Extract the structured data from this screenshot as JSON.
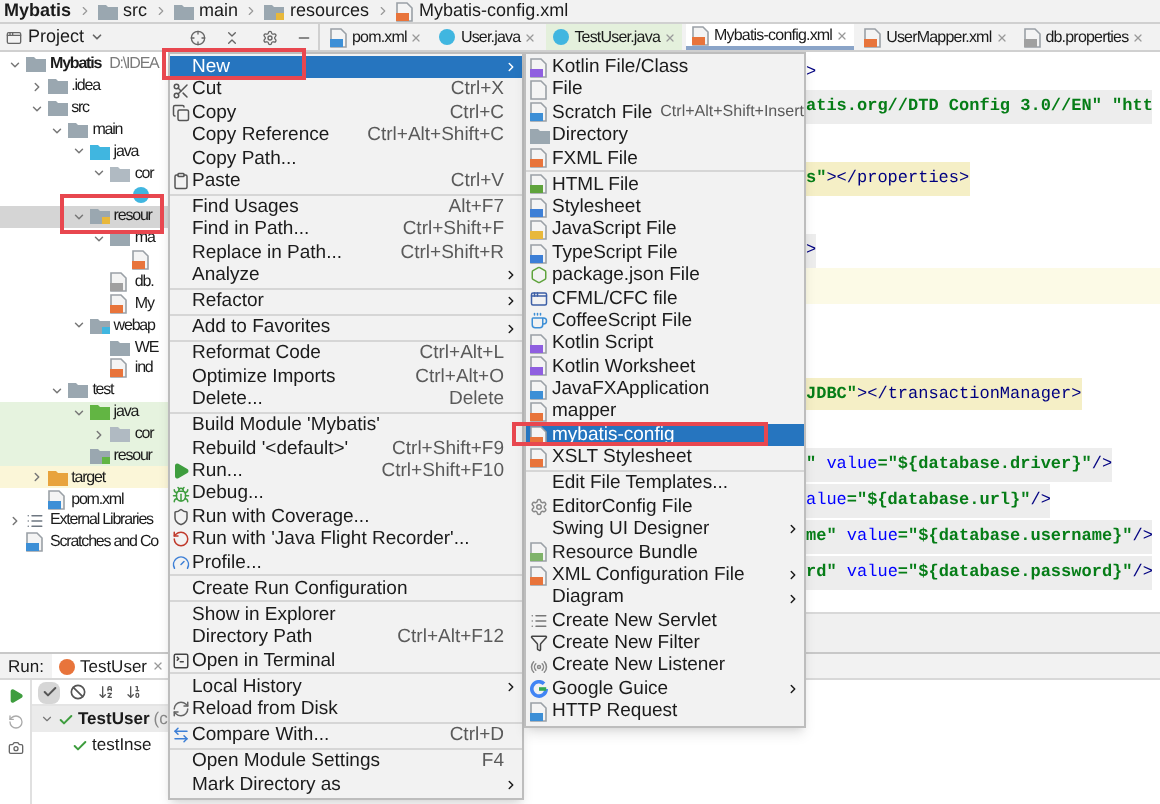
{
  "breadcrumb": [
    {
      "label": "Mybatis",
      "kind": "project"
    },
    {
      "label": "src",
      "kind": "folder"
    },
    {
      "label": "main",
      "kind": "folder"
    },
    {
      "label": "resources",
      "kind": "resource-folder"
    },
    {
      "label": "Mybatis-config.xml",
      "kind": "xml-file"
    }
  ],
  "project_panel": {
    "title": "Project"
  },
  "editor_tabs": [
    {
      "label": "pom.xml",
      "kind": "maven",
      "selected": false
    },
    {
      "label": "User.java",
      "kind": "java",
      "selected": false
    },
    {
      "label": "TestUser.java",
      "kind": "test-java",
      "selected": false
    },
    {
      "label": "Mybatis-config.xml",
      "kind": "xml",
      "selected": true
    },
    {
      "label": "UserMapper.xml",
      "kind": "xml",
      "selected": false
    },
    {
      "label": "db.properties",
      "kind": "properties",
      "selected": false
    }
  ],
  "project_tree": [
    {
      "name": "Mybatis",
      "path": "D:\\IDEA",
      "kind": "project",
      "expanded": true,
      "selected": false,
      "children": [
        {
          "name": ".idea",
          "kind": "folder",
          "expanded": false,
          "selected": false
        },
        {
          "name": "src",
          "kind": "folder",
          "expanded": true,
          "selected": false,
          "children": [
            {
              "name": "main",
              "kind": "folder",
              "expanded": true,
              "selected": false,
              "children": [
                {
                  "name": "java",
                  "kind": "source-folder",
                  "expanded": true,
                  "selected": false,
                  "children": [
                    {
                      "name": "cor",
                      "kind": "package",
                      "expanded": true,
                      "selected": false,
                      "children": [
                        {
                          "kind": "java-class",
                          "selected": false
                        }
                      ]
                    }
                  ]
                },
                {
                  "name": "resour",
                  "kind": "resource-folder",
                  "expanded": true,
                  "selected": true,
                  "children": [
                    {
                      "name": "ma",
                      "kind": "folder",
                      "expanded": true,
                      "selected": false,
                      "children": [
                        {
                          "kind": "xml-file",
                          "selected": false
                        }
                      ]
                    },
                    {
                      "name": "db.",
                      "kind": "properties-file",
                      "selected": false
                    },
                    {
                      "name": "My",
                      "kind": "xml-file",
                      "selected": false
                    }
                  ]
                },
                {
                  "name": "webap",
                  "kind": "web-folder",
                  "expanded": true,
                  "selected": false,
                  "children": [
                    {
                      "name": "WE",
                      "kind": "folder",
                      "selected": false
                    },
                    {
                      "name": "ind",
                      "kind": "html-file",
                      "selected": false
                    }
                  ]
                }
              ]
            },
            {
              "name": "test",
              "kind": "folder",
              "expanded": true,
              "selected": false,
              "children": [
                {
                  "name": "java",
                  "kind": "test-folder",
                  "expanded": true,
                  "selected": false,
                  "children": [
                    {
                      "name": "cor",
                      "kind": "test-package",
                      "expanded": false,
                      "selected": false
                    }
                  ]
                },
                {
                  "name": "resour",
                  "kind": "test-resource-folder",
                  "selected": false
                }
              ]
            }
          ]
        },
        {
          "name": "target",
          "kind": "excluded-folder",
          "expanded": false,
          "selected": false
        },
        {
          "name": "pom.xml",
          "kind": "maven-file",
          "selected": false
        }
      ]
    },
    {
      "name": "External Libraries",
      "kind": "libraries",
      "expanded": false,
      "selected": false
    },
    {
      "name": "Scratches and Co",
      "kind": "scratches",
      "selected": false
    }
  ],
  "editor": {
    "lines": [
      {
        "kind": "plain",
        "segments": [
          {
            "kind": "tag",
            "text": ">"
          }
        ]
      },
      {
        "kind": "shaded",
        "segments": [
          {
            "kind": "doctype",
            "text": "atis.org//DTD Config 3.0//EN\" \"htt"
          }
        ]
      },
      {
        "kind": "blank"
      },
      {
        "kind": "matched",
        "segments": [
          {
            "kind": "value",
            "text": "s\""
          },
          {
            "kind": "tag",
            "text": "></properties>"
          }
        ]
      },
      {
        "kind": "blank"
      },
      {
        "kind": "shaded",
        "segments": [
          {
            "kind": "tag",
            "text": ">"
          }
        ]
      },
      {
        "kind": "current"
      },
      {
        "kind": "blank"
      },
      {
        "kind": "blank"
      },
      {
        "kind": "matched",
        "segments": [
          {
            "kind": "value",
            "text": "JDBC\""
          },
          {
            "kind": "tag",
            "text": "></transactionManager>"
          }
        ]
      },
      {
        "kind": "blank"
      },
      {
        "kind": "shaded",
        "segments": [
          {
            "kind": "value",
            "text": "\""
          },
          {
            "kind": "attr",
            "text": " value"
          },
          {
            "kind": "value",
            "text": "=\"${database.driver}\""
          },
          {
            "kind": "tag",
            "text": "/>"
          }
        ]
      },
      {
        "kind": "shaded",
        "segments": [
          {
            "kind": "attr",
            "text": "alue"
          },
          {
            "kind": "value",
            "text": "=\"${database.url}\""
          },
          {
            "kind": "tag",
            "text": "/>"
          }
        ]
      },
      {
        "kind": "shaded",
        "segments": [
          {
            "kind": "value",
            "text": "me\""
          },
          {
            "kind": "attr",
            "text": " value"
          },
          {
            "kind": "value",
            "text": "=\"${database.username}\""
          },
          {
            "kind": "tag",
            "text": "/>"
          }
        ]
      },
      {
        "kind": "shaded",
        "segments": [
          {
            "kind": "value",
            "text": "rd\""
          },
          {
            "kind": "attr",
            "text": " value"
          },
          {
            "kind": "value",
            "text": "=\"${database.password}\""
          },
          {
            "kind": "tag",
            "text": "/>"
          }
        ]
      }
    ]
  },
  "run_panel": {
    "label": "Run:",
    "tab": {
      "label": "TestUser",
      "selected": true
    },
    "toolbar": [
      {
        "kind": "passed-filter",
        "on": true
      },
      {
        "kind": "ignored-filter",
        "on": false
      },
      {
        "kind": "sort-alpha",
        "on": false
      },
      {
        "kind": "sort-duration",
        "on": false
      }
    ],
    "tree": [
      {
        "name": "TestUser",
        "detail": "(c",
        "passed": true,
        "expanded": true,
        "children": [
          {
            "name": "testInse",
            "passed": true
          }
        ]
      }
    ]
  },
  "context_menu": {
    "items": [
      {
        "kind": "plain",
        "label": "New",
        "submenu": true,
        "selected": true
      },
      {
        "kind": "cut",
        "label": "Cut",
        "shortcut": "Ctrl+X",
        "submenu": false,
        "selected": false
      },
      {
        "kind": "copy",
        "label": "Copy",
        "shortcut": "Ctrl+C",
        "submenu": false,
        "selected": false
      },
      {
        "kind": "plain",
        "label": "Copy Reference",
        "shortcut": "Ctrl+Alt+Shift+C",
        "submenu": false,
        "selected": false
      },
      {
        "kind": "plain",
        "label": "Copy Path...",
        "submenu": false,
        "selected": false
      },
      {
        "kind": "paste",
        "label": "Paste",
        "shortcut": "Ctrl+V",
        "submenu": false,
        "selected": false
      },
      {
        "kind": "separator"
      },
      {
        "kind": "plain",
        "label": "Find Usages",
        "shortcut": "Alt+F7",
        "submenu": false,
        "selected": false
      },
      {
        "kind": "plain",
        "label": "Find in Path...",
        "shortcut": "Ctrl+Shift+F",
        "submenu": false,
        "selected": false
      },
      {
        "kind": "plain",
        "label": "Replace in Path...",
        "shortcut": "Ctrl+Shift+R",
        "submenu": false,
        "selected": false
      },
      {
        "kind": "plain",
        "label": "Analyze",
        "submenu": true,
        "selected": false
      },
      {
        "kind": "separator"
      },
      {
        "kind": "plain",
        "label": "Refactor",
        "submenu": true,
        "selected": false
      },
      {
        "kind": "separator"
      },
      {
        "kind": "plain",
        "label": "Add to Favorites",
        "submenu": true,
        "selected": false
      },
      {
        "kind": "separator"
      },
      {
        "kind": "plain",
        "label": "Reformat Code",
        "shortcut": "Ctrl+Alt+L",
        "submenu": false,
        "selected": false
      },
      {
        "kind": "plain",
        "label": "Optimize Imports",
        "shortcut": "Ctrl+Alt+O",
        "submenu": false,
        "selected": false
      },
      {
        "kind": "plain",
        "label": "Delete...",
        "shortcut": "Delete",
        "submenu": false,
        "selected": false
      },
      {
        "kind": "separator"
      },
      {
        "kind": "plain",
        "label": "Build Module 'Mybatis'",
        "submenu": false,
        "selected": false
      },
      {
        "kind": "plain",
        "label": "Rebuild '<default>'",
        "shortcut": "Ctrl+Shift+F9",
        "submenu": false,
        "selected": false
      },
      {
        "kind": "run",
        "label": "Run...",
        "shortcut": "Ctrl+Shift+F10",
        "submenu": false,
        "selected": false
      },
      {
        "kind": "debug",
        "label": "Debug...",
        "submenu": false,
        "selected": false
      },
      {
        "kind": "coverage",
        "label": "Run with Coverage...",
        "submenu": false,
        "selected": false
      },
      {
        "kind": "recorder",
        "label": "Run with 'Java Flight Recorder'...",
        "submenu": false,
        "selected": false
      },
      {
        "kind": "profile",
        "label": "Profile...",
        "submenu": false,
        "selected": false
      },
      {
        "kind": "separator"
      },
      {
        "kind": "plain",
        "label": "Create Run Configuration",
        "submenu": false,
        "selected": false
      },
      {
        "kind": "separator"
      },
      {
        "kind": "plain",
        "label": "Show in Explorer",
        "submenu": false,
        "selected": false
      },
      {
        "kind": "plain",
        "label": "Directory Path",
        "shortcut": "Ctrl+Alt+F12",
        "submenu": false,
        "selected": false
      },
      {
        "kind": "terminal",
        "label": "Open in Terminal",
        "submenu": false,
        "selected": false
      },
      {
        "kind": "separator"
      },
      {
        "kind": "plain",
        "label": "Local History",
        "submenu": true,
        "selected": false
      },
      {
        "kind": "reload",
        "label": "Reload from Disk",
        "submenu": false,
        "selected": false
      },
      {
        "kind": "separator"
      },
      {
        "kind": "compare",
        "label": "Compare With...",
        "shortcut": "Ctrl+D",
        "submenu": false,
        "selected": false
      },
      {
        "kind": "separator"
      },
      {
        "kind": "plain",
        "label": "Open Module Settings",
        "shortcut": "F4",
        "submenu": false,
        "selected": false
      },
      {
        "kind": "plain",
        "label": "Mark Directory as",
        "submenu": true,
        "selected": false
      }
    ]
  },
  "new_submenu": {
    "items": [
      {
        "kind": "kotlin",
        "label": "Kotlin File/Class",
        "submenu": false,
        "selected": false
      },
      {
        "kind": "file",
        "label": "File",
        "submenu": false,
        "selected": false
      },
      {
        "kind": "scratch",
        "label": "Scratch File",
        "shortcut": "Ctrl+Alt+Shift+Insert",
        "submenu": false,
        "selected": false
      },
      {
        "kind": "directory",
        "label": "Directory",
        "submenu": false,
        "selected": false
      },
      {
        "kind": "xml",
        "label": "FXML File",
        "submenu": false,
        "selected": false
      },
      {
        "kind": "separator"
      },
      {
        "kind": "html",
        "label": "HTML File",
        "submenu": false,
        "selected": false
      },
      {
        "kind": "css",
        "label": "Stylesheet",
        "submenu": false,
        "selected": false
      },
      {
        "kind": "js",
        "label": "JavaScript File",
        "submenu": false,
        "selected": false
      },
      {
        "kind": "ts",
        "label": "TypeScript File",
        "submenu": false,
        "selected": false
      },
      {
        "kind": "json",
        "label": "package.json File",
        "submenu": false,
        "selected": false
      },
      {
        "kind": "cfml",
        "label": "CFML/CFC file",
        "submenu": false,
        "selected": false
      },
      {
        "kind": "coffee",
        "label": "CoffeeScript File",
        "submenu": false,
        "selected": false
      },
      {
        "kind": "kotlin",
        "label": "Kotlin Script",
        "submenu": false,
        "selected": false
      },
      {
        "kind": "kotlin",
        "label": "Kotlin Worksheet",
        "submenu": false,
        "selected": false
      },
      {
        "kind": "javafx",
        "label": "JavaFXApplication",
        "submenu": false,
        "selected": false
      },
      {
        "kind": "xml",
        "label": "mapper",
        "submenu": false,
        "selected": false
      },
      {
        "kind": "xml",
        "label": "mybatis-config",
        "submenu": false,
        "selected": true
      },
      {
        "kind": "xml",
        "label": "XSLT Stylesheet",
        "submenu": false,
        "selected": false
      },
      {
        "kind": "separator"
      },
      {
        "kind": "plain",
        "label": "Edit File Templates...",
        "submenu": false,
        "selected": false
      },
      {
        "kind": "editorconfig",
        "label": "EditorConfig File",
        "submenu": false,
        "selected": false
      },
      {
        "kind": "plain",
        "label": "Swing UI Designer",
        "submenu": true,
        "selected": false
      },
      {
        "kind": "bundle",
        "label": "Resource Bundle",
        "submenu": false,
        "selected": false
      },
      {
        "kind": "xml",
        "label": "XML Configuration File",
        "submenu": true,
        "selected": false
      },
      {
        "kind": "plain",
        "label": "Diagram",
        "submenu": true,
        "selected": false
      },
      {
        "kind": "servlet",
        "label": "Create New Servlet",
        "submenu": false,
        "selected": false
      },
      {
        "kind": "filter",
        "label": "Create New Filter",
        "submenu": false,
        "selected": false
      },
      {
        "kind": "listener",
        "label": "Create New Listener",
        "submenu": false,
        "selected": false
      },
      {
        "kind": "google",
        "label": "Google Guice",
        "submenu": true,
        "selected": false
      },
      {
        "kind": "http",
        "label": "HTTP Request",
        "submenu": false,
        "selected": false
      }
    ]
  }
}
